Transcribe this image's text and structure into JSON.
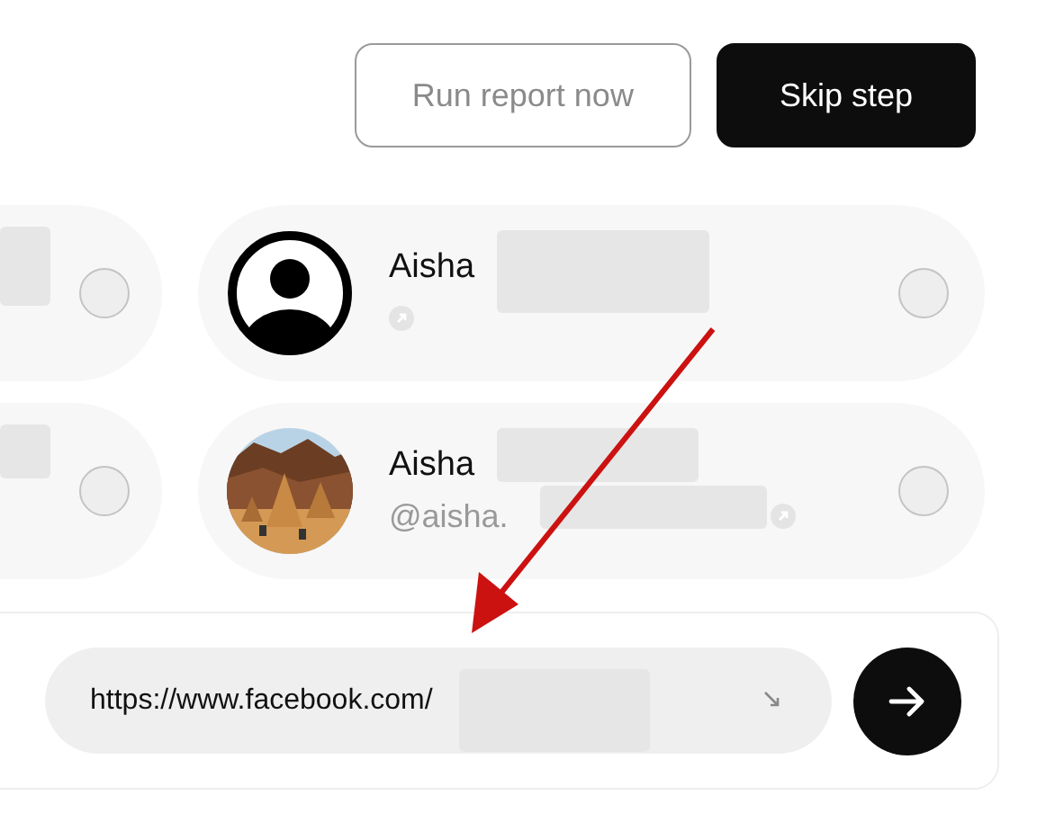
{
  "header": {
    "buttons": [
      {
        "label": "Run report now",
        "kind": "outline"
      },
      {
        "label": "Skip step",
        "kind": "primary"
      }
    ]
  },
  "rows": [
    {
      "left": {
        "selected": false
      },
      "right": {
        "name": "Aisha",
        "avatar": {
          "kind": "silhouette"
        },
        "selected": false
      }
    },
    {
      "left": {
        "selected": false
      },
      "right": {
        "name": "Aisha",
        "handle": "@aisha.",
        "selected": false
      }
    }
  ],
  "url_field": {
    "value": "https://www.facebook.com/"
  }
}
